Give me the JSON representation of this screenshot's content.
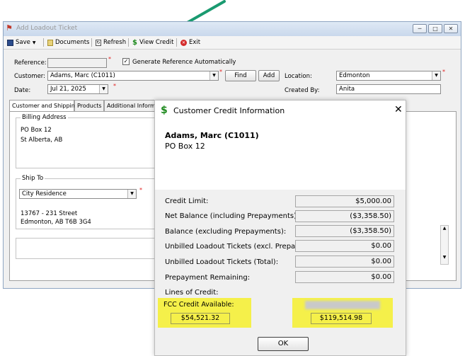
{
  "window": {
    "title": "Add Loadout Ticket",
    "minimize_icon": "minimize-icon",
    "maximize_icon": "maximize-icon",
    "close_icon": "close-icon"
  },
  "toolbar": {
    "save_label": "Save",
    "documents_label": "Documents",
    "refresh_label": "Refresh",
    "view_credit_label": "View Credit",
    "exit_label": "Exit"
  },
  "form": {
    "reference_label": "Reference:",
    "reference_value": "",
    "generate_ref_label": "Generate Reference Automatically",
    "generate_ref_checked": true,
    "customer_label": "Customer:",
    "customer_value": "Adams, Marc (C1011)",
    "find_label": "Find",
    "add_label": "Add",
    "location_label": "Location:",
    "location_value": "Edmonton",
    "date_label": "Date:",
    "date_value": "Jul 21, 2025",
    "created_by_label": "Created By:",
    "created_by_value": "Anita"
  },
  "tabs": [
    {
      "label": "Customer and Shipping",
      "active": true
    },
    {
      "label": "Products",
      "active": false
    },
    {
      "label": "Additional Informati",
      "active": false
    }
  ],
  "billing": {
    "label": "Billing Address",
    "line1": "PO Box 12",
    "line2": "St Alberta, AB"
  },
  "ship_to": {
    "label": "Ship To",
    "selected": "City Residence",
    "line1": "13767 - 231  Street",
    "line2": "Edmonton, AB T6B 3G4"
  },
  "dialog": {
    "title": "Customer Credit Information",
    "customer_name": "Adams, Marc (C1011)",
    "customer_address": "PO Box 12",
    "rows": [
      {
        "label": "Credit Limit:",
        "value": "$5,000.00"
      },
      {
        "label": "Net Balance (including Prepayments):",
        "value": "($3,358.50)"
      },
      {
        "label": "Balance (excluding Prepayments):",
        "value": "($3,358.50)"
      },
      {
        "label": "Unbilled Loadout Tickets (excl. Prepay):",
        "value": "$0.00"
      },
      {
        "label": "Unbilled Loadout Tickets (Total):",
        "value": "$0.00"
      },
      {
        "label": "Prepayment Remaining:",
        "value": "$0.00"
      }
    ],
    "lines_of_credit_label": "Lines of Credit:",
    "fcc_label": "FCC Credit Available:",
    "fcc_value": "$54,521.32",
    "other_credit_value": "$119,514.98",
    "ok_label": "OK"
  },
  "colors": {
    "highlight": "#f5f04a",
    "arrow": "#1a9a70",
    "credit_icon": "#1e8a1e"
  }
}
